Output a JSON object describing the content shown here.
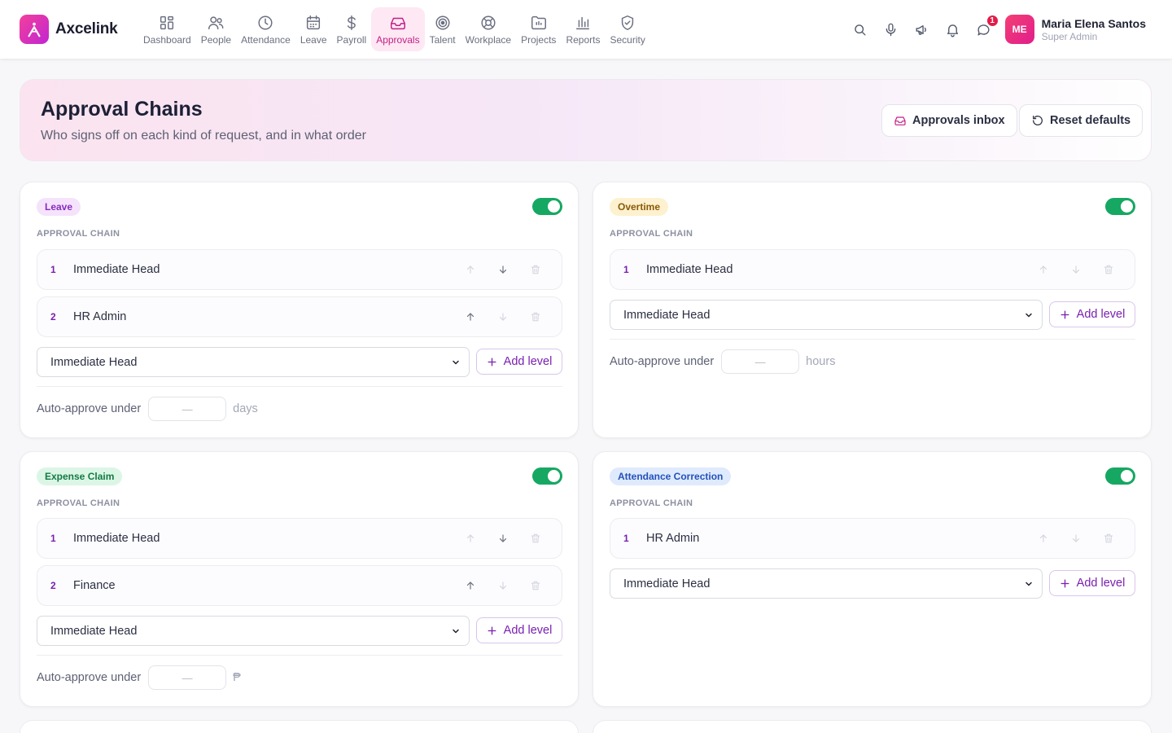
{
  "app": {
    "name": "Axcelink"
  },
  "nav": [
    {
      "label": "Dashboard",
      "icon": "dashboard-icon"
    },
    {
      "label": "People",
      "icon": "people-icon"
    },
    {
      "label": "Attendance",
      "icon": "clock-icon"
    },
    {
      "label": "Leave",
      "icon": "calendar-icon"
    },
    {
      "label": "Payroll",
      "icon": "dollar-icon"
    },
    {
      "label": "Approvals",
      "icon": "inbox-icon",
      "active": true
    },
    {
      "label": "Talent",
      "icon": "target-icon"
    },
    {
      "label": "Workplace",
      "icon": "lifebuoy-icon"
    },
    {
      "label": "Projects",
      "icon": "folder-icon"
    },
    {
      "label": "Reports",
      "icon": "bar-chart-icon"
    },
    {
      "label": "Security",
      "icon": "shield-icon"
    }
  ],
  "top_icons": {
    "messages_badge": "1"
  },
  "user": {
    "initials": "ME",
    "name": "Maria Elena Santos",
    "role": "Super Admin"
  },
  "header": {
    "title": "Approval Chains",
    "subtitle": "Who signs off on each kind of request, and in what order",
    "inbox_button": "Approvals inbox",
    "reset_button": "Reset defaults"
  },
  "common": {
    "chain_label": "APPROVAL CHAIN",
    "add_level": "Add level",
    "auto_label": "Auto-approve under",
    "placeholder": "—"
  },
  "colors": {
    "accent": "#c41f86",
    "toggle_on": "#16a862",
    "step_number": "#7a1fb0"
  },
  "cards": {
    "leave": {
      "type": "Leave",
      "enabled": true,
      "steps": [
        {
          "n": "1",
          "name": "Immediate Head"
        },
        {
          "n": "2",
          "name": "HR Admin"
        }
      ],
      "select_value": "Immediate Head",
      "auto_unit": "days"
    },
    "overtime": {
      "type": "Overtime",
      "enabled": true,
      "steps": [
        {
          "n": "1",
          "name": "Immediate Head"
        }
      ],
      "select_value": "Immediate Head",
      "auto_unit": "hours"
    },
    "expense": {
      "type": "Expense Claim",
      "enabled": true,
      "steps": [
        {
          "n": "1",
          "name": "Immediate Head"
        },
        {
          "n": "2",
          "name": "Finance"
        }
      ],
      "select_value": "Immediate Head",
      "auto_unit": "₱"
    },
    "attendance": {
      "type": "Attendance Correction",
      "enabled": true,
      "steps": [
        {
          "n": "1",
          "name": "HR Admin"
        }
      ],
      "select_value": "Immediate Head"
    }
  }
}
